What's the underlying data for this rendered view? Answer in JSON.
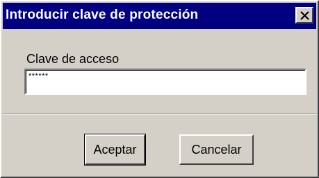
{
  "window": {
    "title": "Introducir clave de protección",
    "close_glyph": "close-icon"
  },
  "form": {
    "label": "Clave de acceso",
    "value": "******"
  },
  "buttons": {
    "accept_label": "Aceptar",
    "cancel_label": "Cancelar"
  },
  "colors": {
    "titlebar": "#000080",
    "face": "#d4d0c8"
  }
}
